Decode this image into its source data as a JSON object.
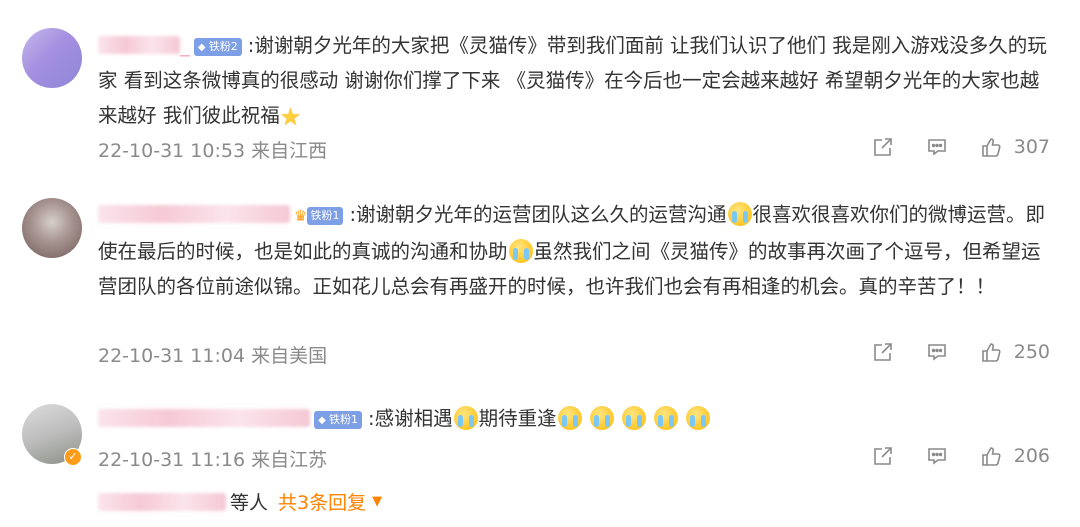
{
  "comments": [
    {
      "fan_badge": "铁粉2",
      "text_parts": [
        ":谢谢朝夕光年的大家把《灵猫传》带到我们面前 让我们认识了他们 我是刚入游戏没多久的玩家 看到这条微博真的很感动 谢谢你们撑了下来 《灵猫传》在今后也一定会越来越好 希望朝夕光年的大家也越来越好 我们彼此祝福"
      ],
      "time": "22-10-31 10:53",
      "location": "来自江西",
      "likes": "307"
    },
    {
      "fan_badge": "铁粉1",
      "text_parts": [
        ":谢谢朝夕光年的运营团队这么久的运营沟通",
        "很喜欢很喜欢你们的微博运营。即使在最后的时候，也是如此的真诚的沟通和协助",
        "虽然我们之间《灵猫传》的故事再次画了个逗号，但希望运营团队的各位前途似锦。正如花儿总会有再盛开的时候，也许我们也会有再相逢的机会。真的辛苦了！！"
      ],
      "time": "22-10-31 11:04",
      "location": "来自美国",
      "likes": "250"
    },
    {
      "fan_badge": "铁粉1",
      "text_parts": [
        ":感谢相遇",
        "期待重逢"
      ],
      "time": "22-10-31 11:16",
      "location": "来自江苏",
      "likes": "206"
    }
  ],
  "reply_footer": {
    "suffix": "等人",
    "more_label": "共3条回复"
  },
  "colors": {
    "accent": "#ff8200",
    "fan_badge": "#7d9fe5",
    "meta_text": "#8a8a8a"
  },
  "icons": [
    "share-icon",
    "comment-icon",
    "like-icon",
    "caret-down-icon",
    "verified-badge-icon",
    "emoji-cry",
    "emoji-star"
  ]
}
